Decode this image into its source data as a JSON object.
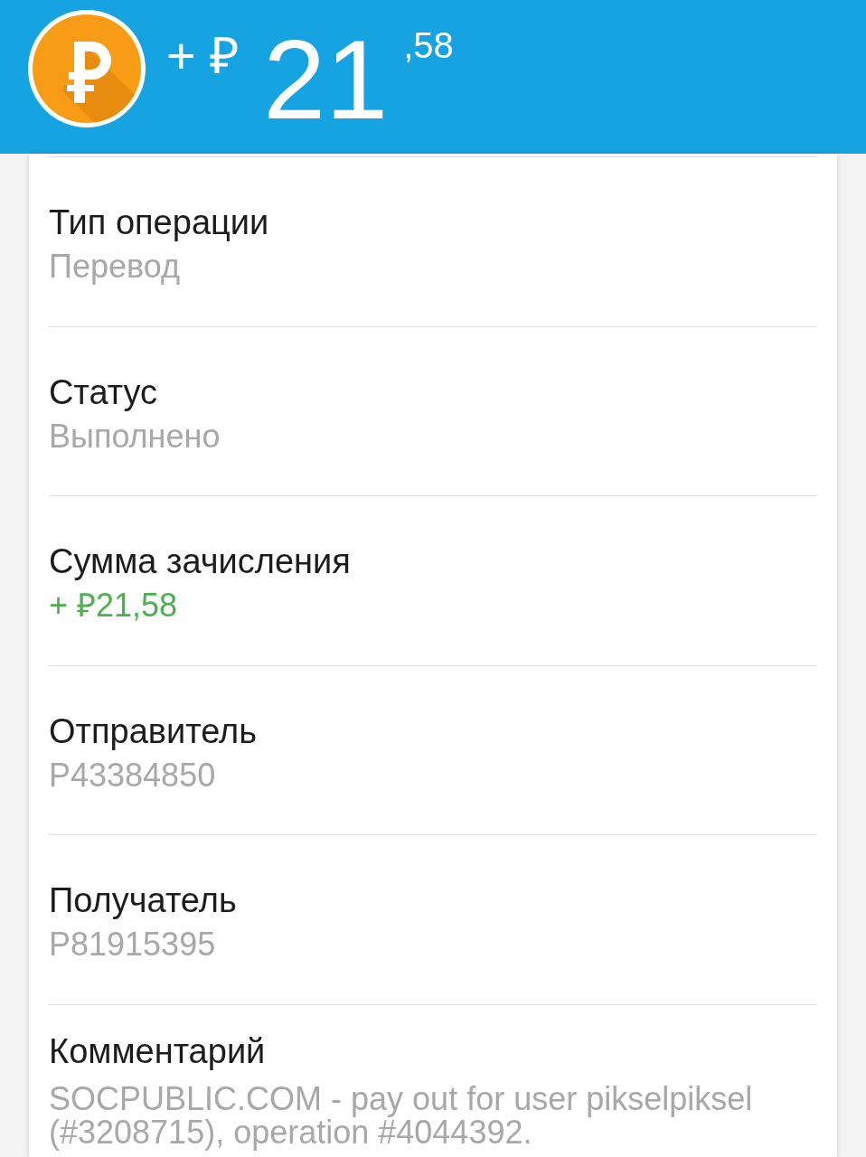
{
  "header": {
    "sign": "+ ₽",
    "amount_whole": "21",
    "amount_fraction": ",58"
  },
  "details": [
    {
      "kind": "text",
      "label": "Тип операции",
      "value": "Перевод"
    },
    {
      "kind": "text",
      "label": "Статус",
      "value": "Выполнено"
    },
    {
      "kind": "amount",
      "label": "Сумма зачисления",
      "value": "+ ₽21,58"
    },
    {
      "kind": "text",
      "label": "Отправитель",
      "value": "P43384850"
    },
    {
      "kind": "text",
      "label": "Получатель",
      "value": "P81915395"
    },
    {
      "kind": "note",
      "label": "Комментарий",
      "value": "SOCPUBLIC.COM - pay out for user pikselpiksel (#3208715), operation #4044392."
    }
  ]
}
